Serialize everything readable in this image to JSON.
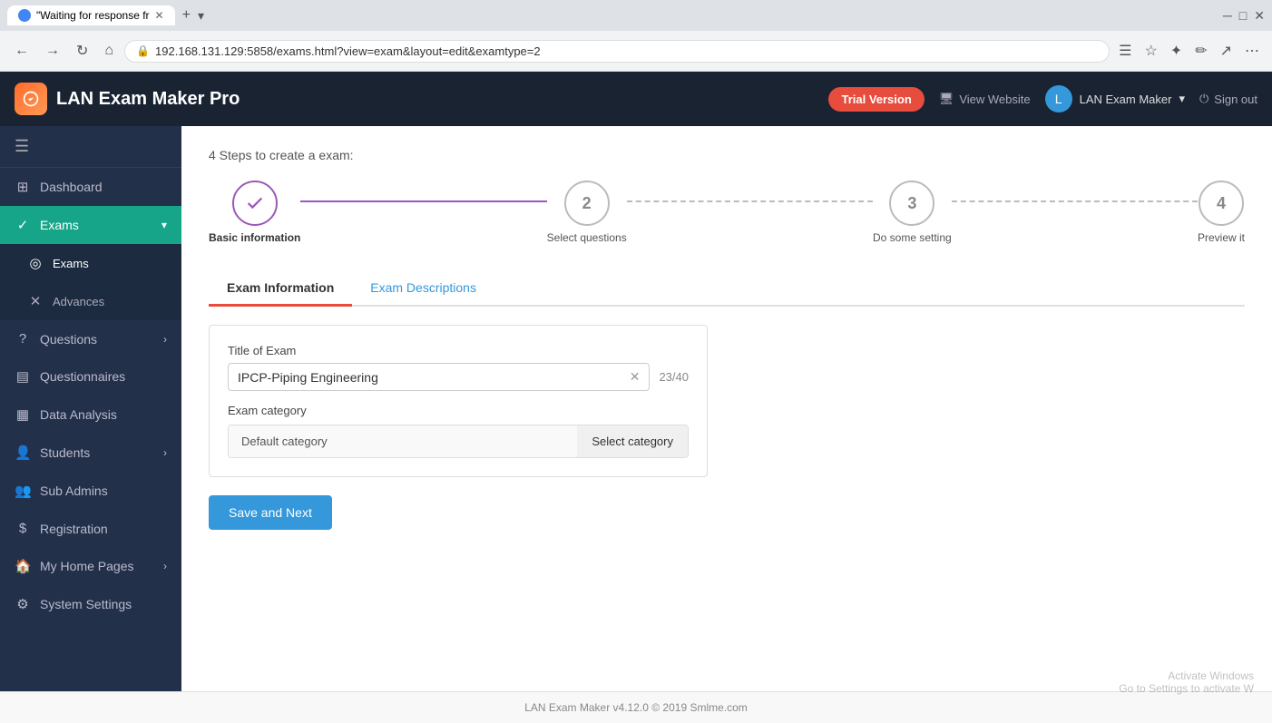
{
  "browser": {
    "tab_title": "\"Waiting for response fr",
    "address": "192.168.131.129:5858/exams.html?view=exam&layout=edit&examtype=2",
    "nav_back": "←",
    "nav_forward": "→",
    "nav_reload": "↻",
    "nav_home": "⌂"
  },
  "header": {
    "app_name": "LAN Exam Maker Pro",
    "trial_badge": "Trial Version",
    "view_website": "View Website",
    "user_name": "LAN Exam Maker",
    "sign_out": "Sign out"
  },
  "sidebar": {
    "items": [
      {
        "id": "dashboard",
        "label": "Dashboard",
        "icon": "⊞",
        "active": false
      },
      {
        "id": "exams",
        "label": "Exams",
        "icon": "✓",
        "active": true,
        "has_arrow": true
      },
      {
        "id": "exams-sub",
        "label": "Exams",
        "icon": "◎",
        "sub": true
      },
      {
        "id": "advances-sub",
        "label": "Advances",
        "icon": "✕",
        "sub": true
      },
      {
        "id": "questions",
        "label": "Questions",
        "icon": "?",
        "has_arrow": true
      },
      {
        "id": "questionnaires",
        "label": "Questionnaires",
        "icon": "▤"
      },
      {
        "id": "data-analysis",
        "label": "Data Analysis",
        "icon": "▦"
      },
      {
        "id": "students",
        "label": "Students",
        "icon": "👤",
        "has_arrow": true
      },
      {
        "id": "sub-admins",
        "label": "Sub Admins",
        "icon": "👥"
      },
      {
        "id": "registration",
        "label": "Registration",
        "icon": "$"
      },
      {
        "id": "my-home-pages",
        "label": "My Home Pages",
        "icon": "🏠",
        "has_arrow": true
      },
      {
        "id": "system-settings",
        "label": "System Settings",
        "icon": "⚙"
      }
    ]
  },
  "content": {
    "steps_title": "4 Steps to create a exam:",
    "steps": [
      {
        "number": "✓",
        "label": "Basic information",
        "state": "completed"
      },
      {
        "number": "2",
        "label": "Select questions",
        "state": "inactive"
      },
      {
        "number": "3",
        "label": "Do some setting",
        "state": "inactive"
      },
      {
        "number": "4",
        "label": "Preview it",
        "state": "inactive"
      }
    ],
    "tabs": [
      {
        "id": "exam-info",
        "label": "Exam Information",
        "active": true
      },
      {
        "id": "exam-desc",
        "label": "Exam Descriptions",
        "active": false
      }
    ],
    "form": {
      "title_label": "Title of Exam",
      "title_value": "IPCP-Piping Engineering",
      "char_count": "23/40",
      "category_label": "Exam category",
      "category_default": "Default category",
      "category_select": "Select category"
    },
    "save_button": "Save and Next"
  },
  "footer": {
    "text": "LAN Exam Maker v4.12.0 © 2019 Smlme.com"
  },
  "watermark": {
    "line1": "Activate Windows",
    "line2": "Go to Settings to activate W"
  }
}
